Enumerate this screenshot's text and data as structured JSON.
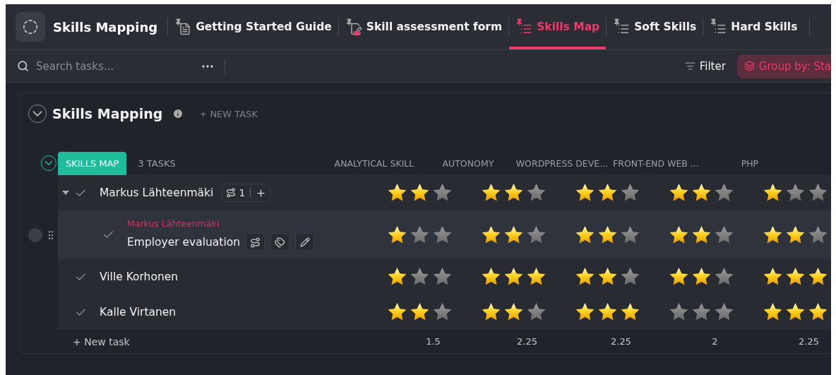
{
  "space": {
    "title": "Skills Mapping"
  },
  "tabs": [
    {
      "label": "Getting Started Guide",
      "kind": "doc",
      "selected": false
    },
    {
      "label": "Skill assessment form",
      "kind": "form",
      "selected": false
    },
    {
      "label": "Skills Map",
      "kind": "list",
      "selected": true
    },
    {
      "label": "Soft Skills",
      "kind": "list",
      "selected": false
    },
    {
      "label": "Hard Skills",
      "kind": "list",
      "selected": false
    }
  ],
  "toolbar": {
    "search": {
      "placeholder": "Search tasks..."
    },
    "filter": "Filter",
    "group_by": "Group by: Sta"
  },
  "list": {
    "title": "Skills Mapping",
    "new_task": "+ NEW TASK"
  },
  "group": {
    "name": "SKILLS MAP",
    "count": "3 TASKS"
  },
  "columns": [
    "ANALYTICAL SKILL",
    "AUTONOMY",
    "WORDPRESS DEVE...",
    "FRONT-END WEB ...",
    "PHP"
  ],
  "tasks": [
    {
      "name": "Markus Lähteenmäki",
      "subtasks": "1",
      "expanded": true,
      "ratings": [
        {
          "stars": 2
        },
        {
          "stars": 2
        },
        {
          "stars": 2
        },
        {
          "stars": 2
        },
        {
          "stars": 1
        }
      ],
      "children": [
        {
          "parent": "Markus Lähteenmäki",
          "name": "Employer evaluation",
          "ratings": [
            {
              "stars": 1
            },
            {
              "stars": 2
            },
            {
              "stars": 2
            },
            {
              "stars": 2
            },
            {
              "stars": 2
            }
          ]
        }
      ]
    },
    {
      "name": "Ville Korhonen",
      "ratings": [
        {
          "stars": 1
        },
        {
          "stars": 3
        },
        {
          "stars": 2
        },
        {
          "stars": 2
        },
        {
          "stars": 3
        }
      ]
    },
    {
      "name": "Kalle Virtanen",
      "ratings": [
        {
          "stars": 2
        },
        {
          "stars": 2
        },
        {
          "stars": 3
        },
        {
          "stars": 0
        },
        {
          "stars": 3
        }
      ]
    }
  ],
  "new_task": "+ New task",
  "totals": [
    "1.5",
    "2.25",
    "2.25",
    "2",
    "2.25"
  ]
}
